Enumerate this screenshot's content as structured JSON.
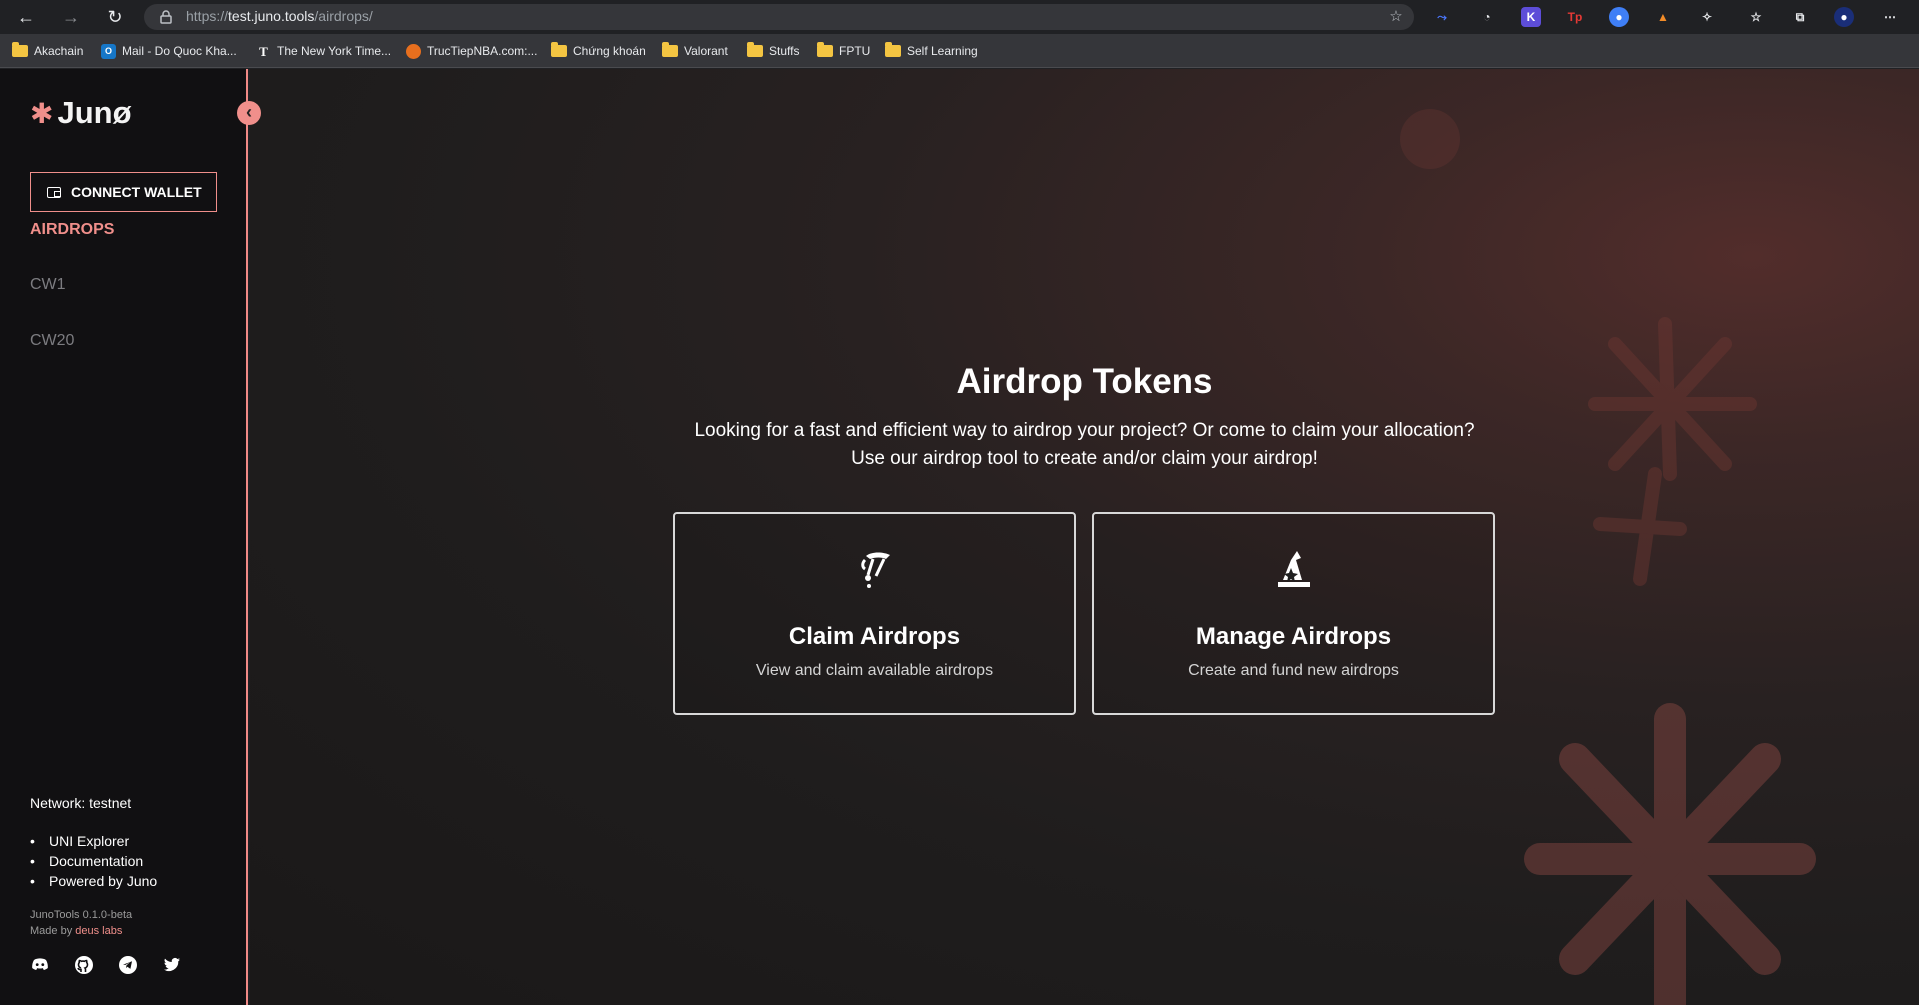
{
  "browser": {
    "url": "https://test.juno.tools/airdrops/",
    "url_scheme": "https://",
    "url_host": "test.juno.tools",
    "url_path": "/airdrops/",
    "bookmarks": [
      {
        "label": "Akachain",
        "icon": "folder-icon"
      },
      {
        "label": "Mail - Do Quoc Kha...",
        "icon": "outlook-icon"
      },
      {
        "label": "The New York Time...",
        "icon": "nyt-icon"
      },
      {
        "label": "TrucTiepNBA.com:...",
        "icon": "basketball-icon"
      },
      {
        "label": "Chứng khoán",
        "icon": "folder-icon"
      },
      {
        "label": "Valorant",
        "icon": "folder-icon"
      },
      {
        "label": "Stuffs",
        "icon": "folder-icon"
      },
      {
        "label": "FPTU",
        "icon": "folder-icon"
      },
      {
        "label": "Self Learning",
        "icon": "folder-icon"
      }
    ]
  },
  "sidebar": {
    "logo": "Junø",
    "connect_wallet": "CONNECT WALLET",
    "nav": [
      "AIRDROPS",
      "CW1",
      "CW20"
    ],
    "network": "Network: testnet",
    "links": [
      "UNI Explorer",
      "Documentation",
      "Powered by Juno"
    ],
    "version": "JunoTools 0.1.0-beta",
    "made_by_prefix": "Made by ",
    "made_by_brand": "deus labs"
  },
  "main": {
    "title": "Airdrop Tokens",
    "subtitle_line1": "Looking for a fast and efficient way to airdrop your project? Or come to claim your allocation?",
    "subtitle_line2": "Use our airdrop tool to create and/or claim your airdrop!",
    "cards": [
      {
        "title": "Claim Airdrops",
        "subtitle": "View and claim available airdrops",
        "icon": "parachute-icon"
      },
      {
        "title": "Manage Airdrops",
        "subtitle": "Create and fund new airdrops",
        "icon": "wizard-hat-icon"
      }
    ]
  },
  "colors": {
    "accent": "#f08f8b",
    "sidebar_bg": "#111012",
    "main_bg": "#1f1d1d"
  }
}
